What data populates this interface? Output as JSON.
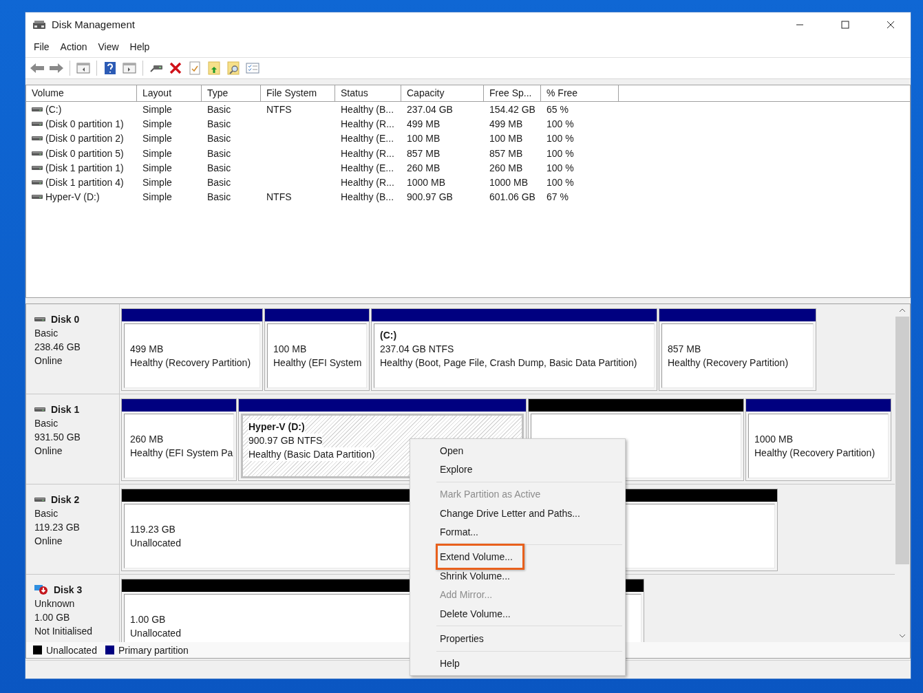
{
  "window": {
    "title": "Disk Management"
  },
  "menu": [
    "File",
    "Action",
    "View",
    "Help"
  ],
  "volume_table": {
    "columns": [
      "Volume",
      "Layout",
      "Type",
      "File System",
      "Status",
      "Capacity",
      "Free Sp...",
      "% Free"
    ],
    "rows": [
      {
        "volume": "(C:)",
        "layout": "Simple",
        "type": "Basic",
        "file_system": "NTFS",
        "status": "Healthy (B...",
        "capacity": "237.04 GB",
        "free_space": "154.42 GB",
        "percent_free": "65 %"
      },
      {
        "volume": "(Disk 0 partition 1)",
        "layout": "Simple",
        "type": "Basic",
        "status": "Healthy (R...",
        "capacity": "499 MB",
        "free_space": "499 MB",
        "percent_free": "100 %"
      },
      {
        "volume": "(Disk 0 partition 2)",
        "layout": "Simple",
        "type": "Basic",
        "status": "Healthy (E...",
        "capacity": "100 MB",
        "free_space": "100 MB",
        "percent_free": "100 %"
      },
      {
        "volume": "(Disk 0 partition 5)",
        "layout": "Simple",
        "type": "Basic",
        "status": "Healthy (R...",
        "capacity": "857 MB",
        "free_space": "857 MB",
        "percent_free": "100 %"
      },
      {
        "volume": "(Disk 1 partition 1)",
        "layout": "Simple",
        "type": "Basic",
        "status": "Healthy (E...",
        "capacity": "260 MB",
        "free_space": "260 MB",
        "percent_free": "100 %"
      },
      {
        "volume": "(Disk 1 partition 4)",
        "layout": "Simple",
        "type": "Basic",
        "status": "Healthy (R...",
        "capacity": "1000 MB",
        "free_space": "1000 MB",
        "percent_free": "100 %"
      },
      {
        "volume": "Hyper-V (D:)",
        "layout": "Simple",
        "type": "Basic",
        "file_system": "NTFS",
        "status": "Healthy (B...",
        "capacity": "900.97 GB",
        "free_space": "601.06 GB",
        "percent_free": "67 %"
      }
    ]
  },
  "disks": [
    {
      "name": "Disk 0",
      "kind": "online",
      "type": "Basic",
      "size": "238.46 GB",
      "state": "Online",
      "partitions": [
        {
          "kind": "primary",
          "selected": false,
          "size": "499 MB",
          "status": "Healthy (Recovery Partition)"
        },
        {
          "kind": "primary",
          "selected": false,
          "size": "100 MB",
          "status": "Healthy (EFI System"
        },
        {
          "kind": "primary",
          "selected": false,
          "name": "(C:)",
          "size": "237.04 GB NTFS",
          "status": "Healthy (Boot, Page File, Crash Dump, Basic Data Partition)"
        },
        {
          "kind": "primary",
          "selected": false,
          "size": "857 MB",
          "status": "Healthy (Recovery Partition)"
        }
      ]
    },
    {
      "name": "Disk 1",
      "kind": "online",
      "type": "Basic",
      "size": "931.50 GB",
      "state": "Online",
      "partitions": [
        {
          "kind": "primary",
          "selected": false,
          "size": "260 MB",
          "status": "Healthy (EFI System Pa"
        },
        {
          "kind": "primary",
          "selected": true,
          "name": "Hyper-V  (D:)",
          "size": "900.97 GB NTFS",
          "status": "Healthy (Basic Data Partition)"
        },
        {
          "kind": "unallocated",
          "selected": false
        },
        {
          "kind": "primary",
          "selected": false,
          "size": "1000 MB",
          "status": "Healthy (Recovery Partition)"
        }
      ]
    },
    {
      "name": "Disk 2",
      "kind": "online",
      "type": "Basic",
      "size": "119.23 GB",
      "state": "Online",
      "partitions": [
        {
          "kind": "unallocated",
          "selected": false,
          "size": "119.23 GB",
          "status": "Unallocated"
        }
      ]
    },
    {
      "name": "Disk 3",
      "kind": "not_initialised",
      "type": "Unknown",
      "size": "1.00 GB",
      "state": "Not Initialised",
      "partitions": [
        {
          "kind": "unallocated",
          "selected": false,
          "size": "1.00 GB",
          "status": "Unallocated"
        }
      ]
    }
  ],
  "legend": [
    {
      "label": "Unallocated",
      "color": "#000000"
    },
    {
      "label": "Primary partition",
      "color": "#000080"
    }
  ],
  "context_menu": [
    {
      "kind": "item",
      "label": "Open",
      "disabled": false,
      "outlined": false
    },
    {
      "kind": "item",
      "label": "Explore",
      "disabled": false,
      "outlined": false
    },
    {
      "kind": "separator"
    },
    {
      "kind": "item",
      "label": "Mark Partition as Active",
      "disabled": true,
      "outlined": false
    },
    {
      "kind": "item",
      "label": "Change Drive Letter and Paths...",
      "disabled": false,
      "outlined": false
    },
    {
      "kind": "item",
      "label": "Format...",
      "disabled": false,
      "outlined": false
    },
    {
      "kind": "separator"
    },
    {
      "kind": "item",
      "label": "Extend Volume...",
      "disabled": false,
      "outlined": true
    },
    {
      "kind": "item",
      "label": "Shrink Volume...",
      "disabled": false,
      "outlined": false
    },
    {
      "kind": "item",
      "label": "Add Mirror...",
      "disabled": true,
      "outlined": false
    },
    {
      "kind": "item",
      "label": "Delete Volume...",
      "disabled": false,
      "outlined": false
    },
    {
      "kind": "separator"
    },
    {
      "kind": "item",
      "label": "Properties",
      "disabled": false,
      "outlined": false
    },
    {
      "kind": "separator"
    },
    {
      "kind": "item",
      "label": "Help",
      "disabled": false,
      "outlined": false
    }
  ]
}
